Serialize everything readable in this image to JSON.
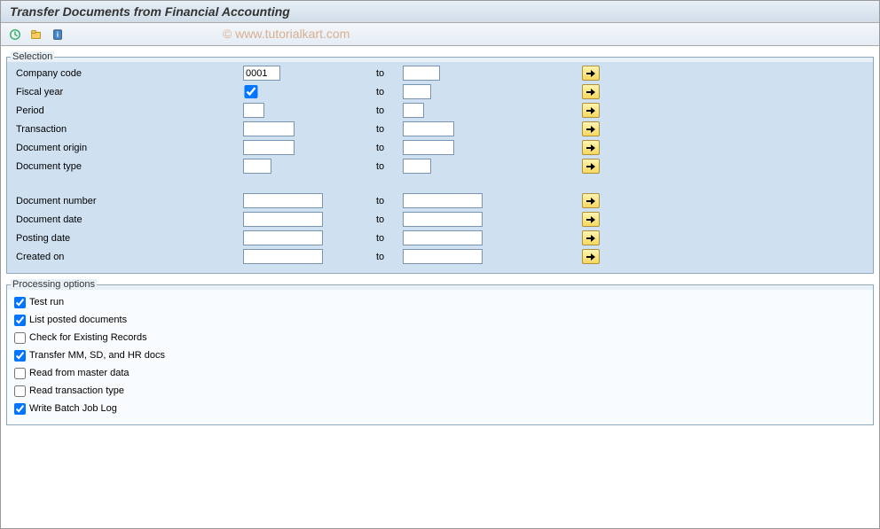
{
  "title": "Transfer Documents from Financial Accounting",
  "watermark": "© www.tutorialkart.com",
  "selection": {
    "legend": "Selection",
    "to_label": "to",
    "rows1": [
      {
        "label": "Company code",
        "from": "0001",
        "fclass": "w-code",
        "to": "",
        "tclass": "w-code"
      },
      {
        "label": "Fiscal year",
        "from": "",
        "fclass": "w-check",
        "to": "",
        "tclass": "w-short",
        "checkbox": true
      },
      {
        "label": "Period",
        "from": "",
        "fclass": "w-tiny",
        "to": "",
        "tclass": "w-tiny"
      },
      {
        "label": "Transaction",
        "from": "",
        "fclass": "w-small",
        "to": "",
        "tclass": "w-small"
      },
      {
        "label": "Document origin",
        "from": "",
        "fclass": "w-small",
        "to": "",
        "tclass": "w-small"
      },
      {
        "label": "Document type",
        "from": "",
        "fclass": "w-short",
        "to": "",
        "tclass": "w-short"
      }
    ],
    "rows2": [
      {
        "label": "Document number",
        "from": "",
        "fclass": "w-med",
        "to": "",
        "tclass": "w-med"
      },
      {
        "label": "Document date",
        "from": "",
        "fclass": "w-med",
        "to": "",
        "tclass": "w-med"
      },
      {
        "label": "Posting date",
        "from": "",
        "fclass": "w-med",
        "to": "",
        "tclass": "w-med"
      },
      {
        "label": "Created on",
        "from": "",
        "fclass": "w-med",
        "to": "",
        "tclass": "w-med"
      }
    ]
  },
  "processing": {
    "legend": "Processing options",
    "options": [
      {
        "label": "Test run",
        "checked": true
      },
      {
        "label": "List posted documents",
        "checked": true
      },
      {
        "label": "Check for Existing Records",
        "checked": false
      },
      {
        "label": "Transfer MM, SD, and HR docs",
        "checked": true
      },
      {
        "label": "Read from master data",
        "checked": false
      },
      {
        "label": "Read transaction type",
        "checked": false
      },
      {
        "label": "Write Batch Job Log",
        "checked": true
      }
    ]
  }
}
